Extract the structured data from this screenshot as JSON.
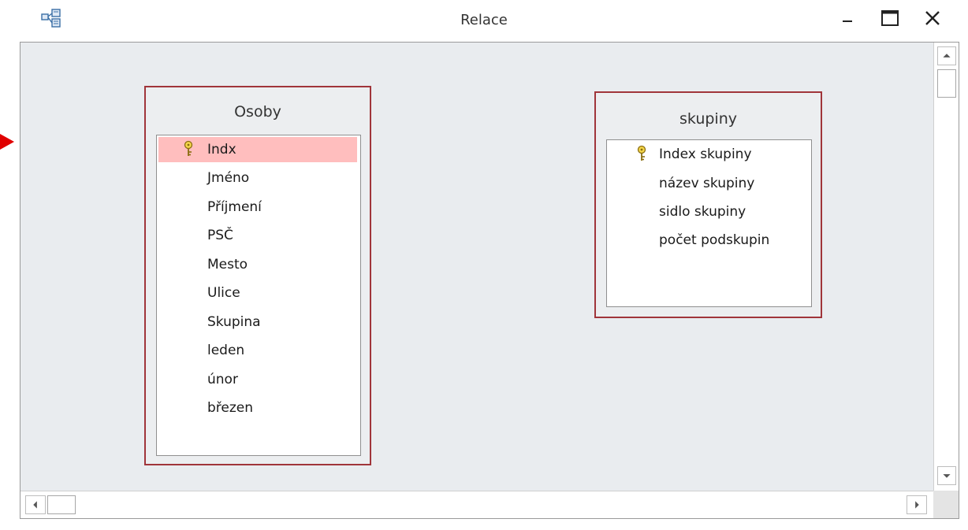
{
  "window": {
    "title": "Relace",
    "icon": "relationships-icon",
    "controls": {
      "minimize": "minimize-icon",
      "maximize": "maximize-icon",
      "close": "close-icon"
    }
  },
  "tables": [
    {
      "name": "Osoby",
      "fields": [
        {
          "label": "Indx",
          "primary_key": true,
          "selected": true
        },
        {
          "label": "Jméno"
        },
        {
          "label": "Příjmení"
        },
        {
          "label": "PSČ"
        },
        {
          "label": "Mesto"
        },
        {
          "label": "Ulice"
        },
        {
          "label": "Skupina"
        },
        {
          "label": "leden"
        },
        {
          "label": "únor"
        },
        {
          "label": "březen"
        }
      ]
    },
    {
      "name": "skupiny",
      "fields": [
        {
          "label": "Index skupiny",
          "primary_key": true
        },
        {
          "label": "název skupiny"
        },
        {
          "label": "sidlo skupiny"
        },
        {
          "label": "počet podskupin"
        }
      ]
    }
  ],
  "colors": {
    "table_border": "#a0353a",
    "selected_row": "#ffbebe",
    "canvas": "#e9ecef",
    "relation_arrow": "#e00000",
    "key_icon": "#d4b12a"
  }
}
